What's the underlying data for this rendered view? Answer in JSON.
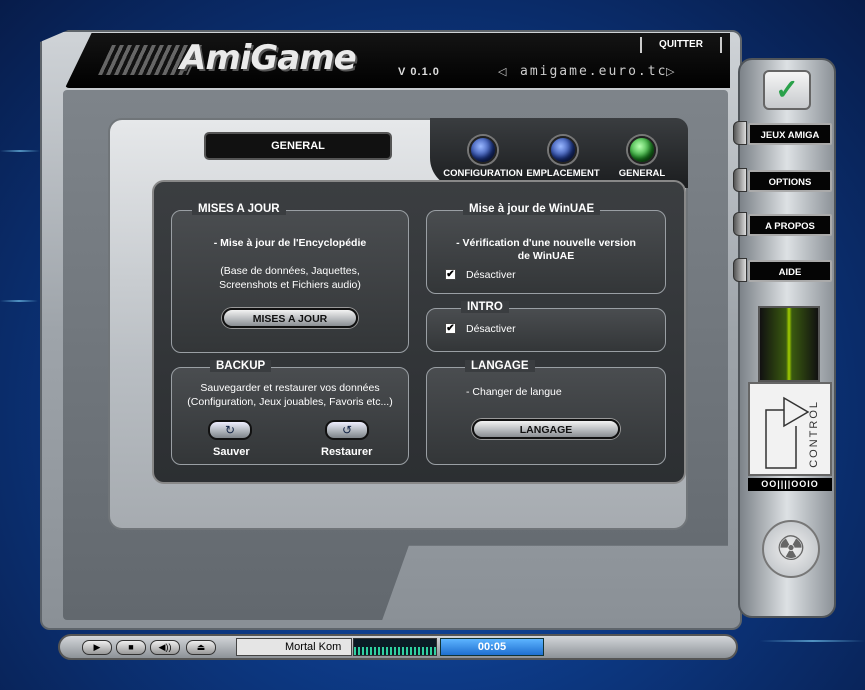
{
  "window": {
    "version": "V 0.1.0",
    "site": "amigame.euro.tc",
    "quit_label": "QUITTER",
    "logo": "AmiGame"
  },
  "tabs": [
    {
      "label": "CONFIGURATION",
      "color": "blue"
    },
    {
      "label": "EMPLACEMENT",
      "color": "blue"
    },
    {
      "label": "GENERAL",
      "color": "green",
      "active": true
    }
  ],
  "panel_title": "GENERAL",
  "updates": {
    "title": "MISES A JOUR",
    "line1": "- Mise à jour de l'Encyclopédie",
    "line2": "(Base de données, Jaquettes,",
    "line3": "Screenshots et Fichiers audio)",
    "button": "MISES A JOUR"
  },
  "winuae": {
    "title": "Mise à jour de WinUAE",
    "line1": "- Vérification d'une nouvelle version",
    "line2": "de WinUAE",
    "checkbox_label": "Désactiver",
    "checked": true
  },
  "intro": {
    "title": "INTRO",
    "checkbox_label": "Désactiver",
    "checked": true
  },
  "backup": {
    "title": "BACKUP",
    "line1": "Sauvegarder et restaurer vos données",
    "line2": "(Configuration, Jeux jouables, Favoris etc...)",
    "save_label": "Sauver",
    "restore_label": "Restaurer"
  },
  "language": {
    "title": "LANGAGE",
    "line1": "- Changer de langue",
    "button": "LANGAGE"
  },
  "side_nav": [
    {
      "label": "JEUX AMIGA"
    },
    {
      "label": "OPTIONS"
    },
    {
      "label": "A PROPOS"
    },
    {
      "label": "AIDE"
    }
  ],
  "control_label": "CONTROL",
  "binary_label": "OO||||OOIO",
  "player": {
    "track": "Mortal Kom",
    "time": "00:05",
    "buttons": [
      "play-icon",
      "stop-icon",
      "volume-icon",
      "eject-icon"
    ]
  },
  "colors": {
    "accent_green": "#22a02a",
    "accent_blue": "#2240a0",
    "time_bg": "#1e6fd0"
  }
}
